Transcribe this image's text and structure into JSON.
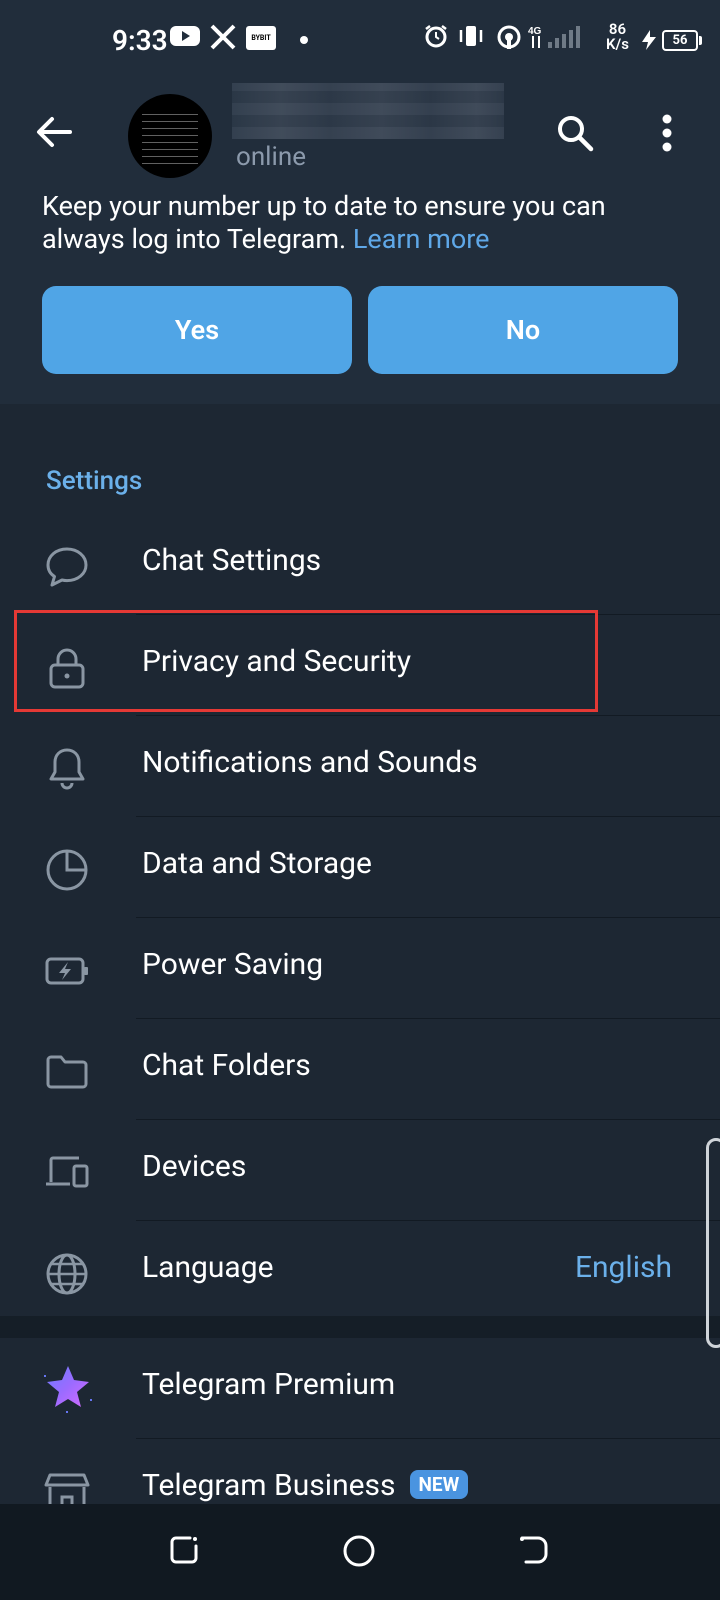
{
  "status_bar": {
    "time": "9:33",
    "speed_value": "86",
    "speed_unit": "K/s",
    "battery": "56",
    "app_icons": [
      "youtube-icon",
      "x-icon",
      "bybit-icon"
    ],
    "bybit_label": "BYBIT"
  },
  "header": {
    "status": "online"
  },
  "notice": {
    "text": "Keep your number up to date to ensure you can always log into Telegram.",
    "link": "Learn more",
    "yes_label": "Yes",
    "no_label": "No"
  },
  "settings": {
    "title": "Settings",
    "items": [
      {
        "label": "Chat Settings",
        "icon": "chat-bubble-icon"
      },
      {
        "label": "Privacy and Security",
        "icon": "lock-icon"
      },
      {
        "label": "Notifications and Sounds",
        "icon": "bell-icon"
      },
      {
        "label": "Data and Storage",
        "icon": "pie-chart-icon"
      },
      {
        "label": "Power Saving",
        "icon": "battery-bolt-icon"
      },
      {
        "label": "Chat Folders",
        "icon": "folder-icon"
      },
      {
        "label": "Devices",
        "icon": "devices-icon"
      },
      {
        "label": "Language",
        "icon": "globe-icon",
        "value": "English"
      }
    ]
  },
  "extras": {
    "premium_label": "Telegram Premium",
    "business_label": "Telegram Business",
    "business_badge": "NEW"
  },
  "colors": {
    "accent": "#50a5e6",
    "link": "#6bb0ea",
    "background": "#1d2733",
    "highlight": "#e53935"
  }
}
